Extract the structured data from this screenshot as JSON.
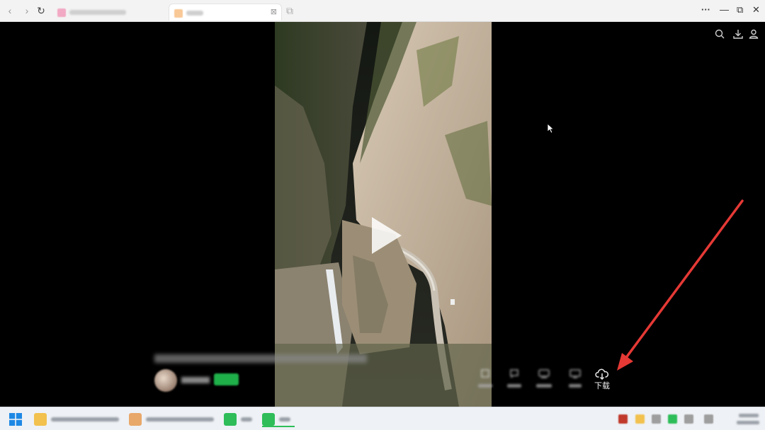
{
  "browser": {
    "back_icon": "chevron-left",
    "forward_icon": "chevron-right",
    "refresh_icon": "refresh",
    "tabs": [
      {
        "state": "inactive",
        "favicon_color": "#f28bb0"
      },
      {
        "state": "active",
        "favicon_color": "#f6b26b"
      }
    ],
    "window_controls": [
      "more",
      "minimize",
      "restore",
      "close"
    ],
    "glyphs": {
      "more": "···",
      "minimize": "—",
      "restore": "⧉",
      "close": "✕",
      "back": "‹",
      "forward": "›",
      "refresh": "↻",
      "new_tab": "⧉",
      "tab_close": "⊠"
    }
  },
  "player": {
    "top_icons": [
      "search",
      "download",
      "user"
    ],
    "download_label": "下载",
    "annotation_color": "#e53935"
  },
  "taskbar": {
    "start_icon": "windows-logo",
    "apps": [
      {
        "icon_color": "#f2c14e"
      },
      {
        "icon_color": "#e8a86a"
      },
      {
        "icon_color": "#2ebd59"
      },
      {
        "icon_color": "#2ebd59"
      }
    ],
    "tray_colors": [
      "#c0392b",
      "#f2c14e",
      "#9e9e9e",
      "#2ebd59",
      "#9e9e9e",
      "#9e9e9e"
    ]
  }
}
